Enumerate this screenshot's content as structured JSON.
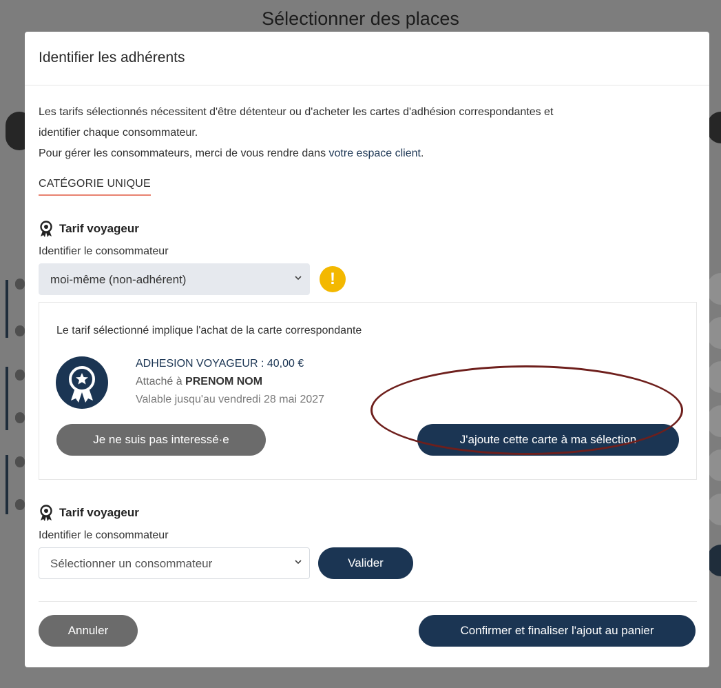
{
  "page": {
    "title": "Sélectionner des places"
  },
  "modal": {
    "title": "Identifier les adhérents",
    "intro_line1": "Les tarifs sélectionnés nécessitent d'être détenteur ou d'acheter les cartes d'adhésion correspondantes et",
    "intro_line2": "identifier chaque consommateur.",
    "intro_line3_prefix": "Pour gérer les consommateurs, merci de vous rendre dans ",
    "intro_line3_link": "votre espace client",
    "intro_line3_suffix": ".",
    "category_label": "CATÉGORIE UNIQUE"
  },
  "tarif1": {
    "heading": "Tarif voyageur",
    "field_label": "Identifier le consommateur",
    "select_value": "moi-même (non-adhérent)",
    "warning_symbol": "!"
  },
  "card_offer": {
    "notice": "Le tarif sélectionné implique l'achat de la carte correspondante",
    "name_price": "ADHESION VOYAGEUR : 40,00 €",
    "attached_prefix": "Attaché à ",
    "attached_name": "PRENOM NOM",
    "validity": "Valable jusqu'au vendredi 28 mai 2027",
    "not_interested_label": "Je ne suis pas interessé·e",
    "add_card_label": "J'ajoute cette carte à ma sélection"
  },
  "tarif2": {
    "heading": "Tarif voyageur",
    "field_label": "Identifier le consommateur",
    "select_placeholder": "Sélectionner un consommateur",
    "validate_label": "Valider"
  },
  "footer": {
    "cancel_label": "Annuler",
    "confirm_label": "Confirmer et finaliser l'ajout au panier"
  },
  "colors": {
    "navy": "#1b3553",
    "grey_button": "#6b6b6b",
    "warning": "#f3b800",
    "category_underline": "#e8816f",
    "highlight_ring": "#6e1f1c"
  },
  "icons": {
    "tarif": "award-ribbon-icon",
    "warning": "exclamation-icon",
    "card": "star-medal-icon",
    "select": "chevron-down-icon"
  }
}
